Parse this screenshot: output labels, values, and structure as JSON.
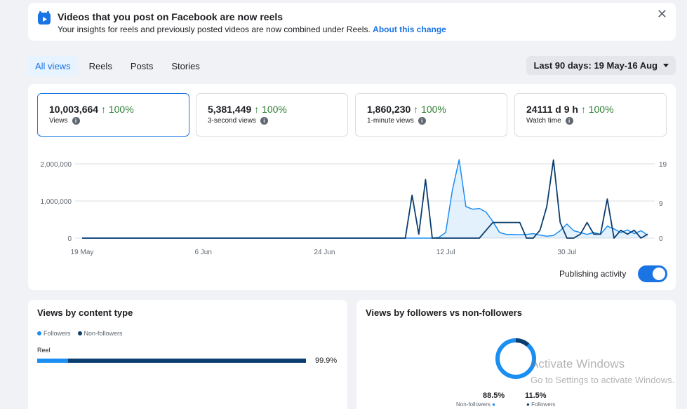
{
  "banner": {
    "title": "Videos that you post on Facebook are now reels",
    "subtitle": "Your insights for reels and previously posted videos are now combined under Reels.",
    "link": "About this change",
    "close": "✕"
  },
  "tabs": [
    "All views",
    "Reels",
    "Posts",
    "Stories"
  ],
  "date_range": "Last 90 days: 19 May-16 Aug",
  "metrics": [
    {
      "value": "10,003,664",
      "delta": "↑ 100%",
      "label": "Views"
    },
    {
      "value": "5,381,449",
      "delta": "↑ 100%",
      "label": "3-second views"
    },
    {
      "value": "1,860,230",
      "delta": "↑ 100%",
      "label": "1-minute views"
    },
    {
      "value": "24111 d 9 h",
      "delta": "↑ 100%",
      "label": "Watch time"
    }
  ],
  "publishing_activity": "Publishing activity",
  "chart_data": {
    "type": "line",
    "x_tick_labels": [
      "19 May",
      "6 Jun",
      "24 Jun",
      "12 Jul",
      "30 Jul"
    ],
    "y_left_ticks": [
      "2,000,000",
      "1,000,000",
      "0"
    ],
    "y_right_ticks": [
      "19",
      "9",
      "0"
    ],
    "ylim_left": [
      0,
      2000000
    ],
    "ylim_right": [
      0,
      19
    ],
    "x_start_date": "2024-05-19",
    "series": [
      {
        "color": "#1b8ef2",
        "axis": "left",
        "style": "area",
        "points": [
          [
            0,
            0
          ],
          [
            52,
            0
          ],
          [
            53,
            20000
          ],
          [
            54,
            150000
          ],
          [
            55,
            1300000
          ],
          [
            56,
            2150000
          ],
          [
            57,
            850000
          ],
          [
            58,
            780000
          ],
          [
            59,
            800000
          ],
          [
            60,
            700000
          ],
          [
            61,
            450000
          ],
          [
            62,
            150000
          ],
          [
            63,
            100000
          ],
          [
            64,
            100000
          ],
          [
            65,
            90000
          ],
          [
            66,
            100000
          ],
          [
            67,
            120000
          ],
          [
            68,
            80000
          ],
          [
            69,
            50000
          ],
          [
            70,
            70000
          ],
          [
            71,
            200000
          ],
          [
            72,
            380000
          ],
          [
            73,
            200000
          ],
          [
            74,
            150000
          ],
          [
            75,
            100000
          ],
          [
            76,
            150000
          ],
          [
            77,
            100000
          ],
          [
            78,
            320000
          ],
          [
            79,
            250000
          ],
          [
            80,
            150000
          ],
          [
            81,
            220000
          ],
          [
            82,
            120000
          ],
          [
            83,
            200000
          ],
          [
            84,
            80000
          ]
        ]
      },
      {
        "color": "#0b3d6e",
        "axis": "right",
        "style": "line",
        "points": [
          [
            0,
            0
          ],
          [
            48,
            0
          ],
          [
            49,
            11
          ],
          [
            50,
            1
          ],
          [
            51,
            15
          ],
          [
            52,
            0
          ],
          [
            59,
            0
          ],
          [
            60,
            2
          ],
          [
            61,
            4
          ],
          [
            62,
            4
          ],
          [
            63,
            4
          ],
          [
            64,
            4
          ],
          [
            65,
            4
          ],
          [
            66,
            0
          ],
          [
            67,
            0
          ],
          [
            68,
            2
          ],
          [
            69,
            8
          ],
          [
            70,
            20
          ],
          [
            71,
            4
          ],
          [
            72,
            0
          ],
          [
            73,
            0
          ],
          [
            74,
            1
          ],
          [
            75,
            4
          ],
          [
            76,
            1
          ],
          [
            77,
            1
          ],
          [
            78,
            10
          ],
          [
            79,
            0
          ],
          [
            80,
            2
          ],
          [
            81,
            1
          ],
          [
            82,
            2
          ],
          [
            83,
            0
          ],
          [
            84,
            1
          ]
        ]
      }
    ]
  },
  "content_type": {
    "title": "Views by content type",
    "legend": [
      "Followers",
      "Non-followers"
    ],
    "row_label": "Reel",
    "row_pct": "99.9%",
    "followers_share": 0.115,
    "colors": {
      "followers": "#1b8ef2",
      "non_followers": "#0b3d6e"
    }
  },
  "followers": {
    "title": "Views by followers vs non-followers",
    "non_followers_pct": "88.5%",
    "non_followers_label": "Non-followers",
    "followers_pct": "11.5%",
    "followers_label": "Followers",
    "non_followers_share": 0.885
  },
  "watermark": {
    "line1": "Activate Windows",
    "line2": "Go to Settings to activate Windows."
  }
}
